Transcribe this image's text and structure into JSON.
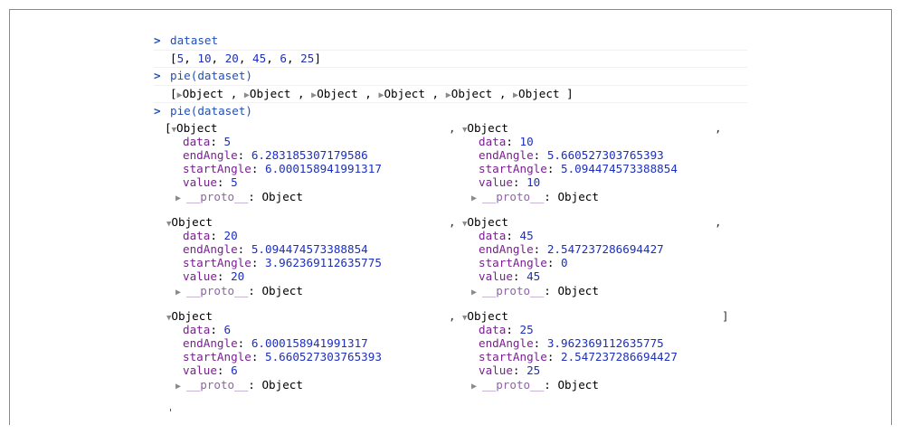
{
  "console": {
    "prompt_glyph": ">",
    "cmd1": "dataset",
    "out1": "[5, 10, 20, 45, 6, 25]",
    "cmd2": "pie(dataset)",
    "out2_items": [
      "Object",
      "Object",
      "Object",
      "Object",
      "Object",
      "Object"
    ],
    "cmd3": "pie(dataset)",
    "collapsed_arrow": "▶",
    "expanded_arrow": "▼",
    "open_bracket": "[",
    "close_bracket": "]",
    "comma": ",",
    "object_label": "Object",
    "proto_key": "__proto__",
    "proto_value": "Object",
    "objects": [
      {
        "data": "5",
        "endAngle": "6.283185307179586",
        "startAngle": "6.000158941991317",
        "value": "5"
      },
      {
        "data": "10",
        "endAngle": "5.660527303765393",
        "startAngle": "5.094474573388854",
        "value": "10"
      },
      {
        "data": "20",
        "endAngle": "5.094474573388854",
        "startAngle": "3.962369112635775",
        "value": "20"
      },
      {
        "data": "45",
        "endAngle": "2.547237286694427",
        "startAngle": "0",
        "value": "45"
      },
      {
        "data": "6",
        "endAngle": "6.000158941991317",
        "startAngle": "5.660527303765393",
        "value": "6"
      },
      {
        "data": "25",
        "endAngle": "3.962369112635775",
        "startAngle": "2.547237286694427",
        "value": "25"
      }
    ],
    "keys": {
      "data": "data",
      "endAngle": "endAngle",
      "startAngle": "startAngle",
      "value": "value"
    }
  }
}
